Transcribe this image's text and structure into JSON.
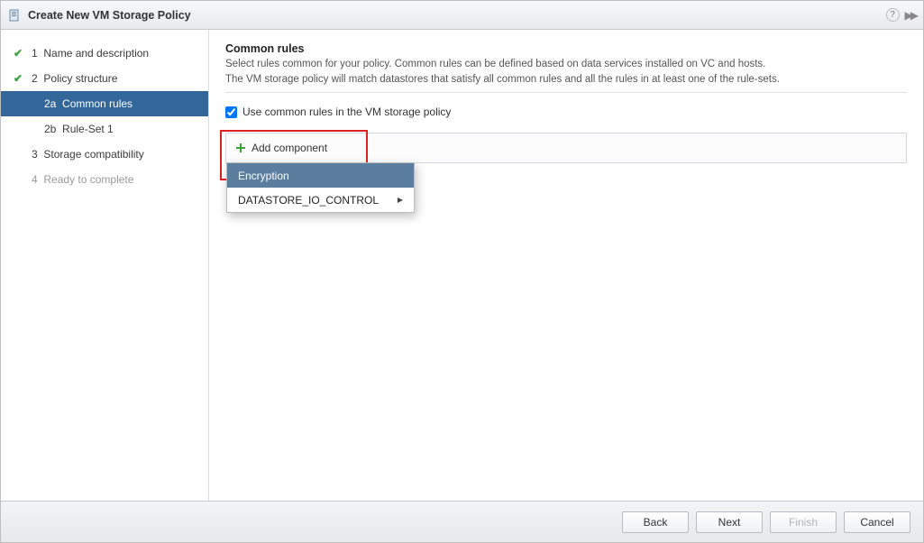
{
  "titlebar": {
    "title": "Create New VM Storage Policy"
  },
  "sidebar": {
    "steps": [
      {
        "num": "1",
        "label": "Name and description",
        "checked": true
      },
      {
        "num": "2",
        "label": "Policy structure",
        "checked": true
      },
      {
        "num": "2a",
        "label": "Common rules",
        "active": true
      },
      {
        "num": "2b",
        "label": "Rule-Set 1"
      },
      {
        "num": "3",
        "label": "Storage compatibility"
      },
      {
        "num": "4",
        "label": "Ready to complete",
        "disabled": true
      }
    ]
  },
  "main": {
    "section_title": "Common rules",
    "description_line1": "Select rules common for your policy. Common rules can be defined based on data services installed on VC and hosts.",
    "description_line2": "The VM storage policy will match datastores that satisfy all common rules and all the rules in at least one of the rule-sets.",
    "checkbox_label": "Use common rules in the VM storage policy",
    "checkbox_checked": true,
    "add_component_label": "Add component",
    "dropdown": {
      "items": [
        {
          "label": "Encryption",
          "selected": true
        },
        {
          "label": "DATASTORE_IO_CONTROL",
          "has_submenu": true
        }
      ]
    }
  },
  "footer": {
    "back": "Back",
    "next": "Next",
    "finish": "Finish",
    "cancel": "Cancel"
  }
}
